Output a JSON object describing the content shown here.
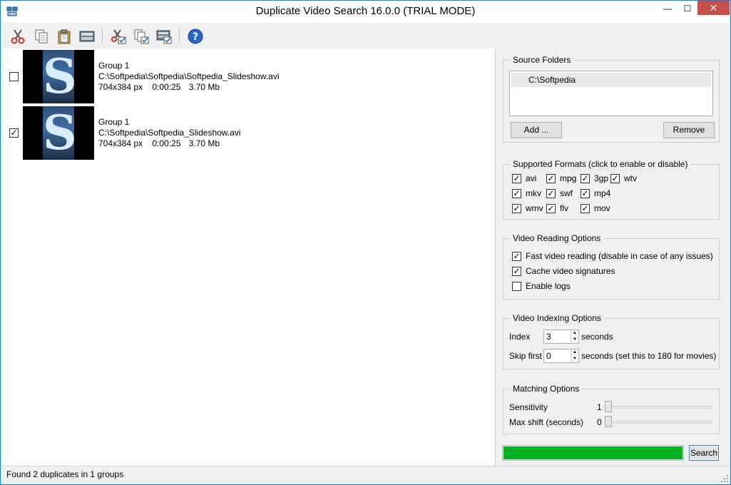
{
  "window": {
    "title": "Duplicate Video Search 16.0.0 (TRIAL MODE)",
    "minimize_glyph": "—",
    "maximize_glyph": "☐",
    "close_glyph": "✕"
  },
  "toolbar": {
    "buttons": [
      {
        "name": "cut-icon"
      },
      {
        "name": "copy-icon"
      },
      {
        "name": "paste-icon"
      },
      {
        "name": "delete-icon"
      },
      {
        "name": "cut-checked-icon"
      },
      {
        "name": "copy-checked-icon"
      },
      {
        "name": "delete-checked-icon"
      },
      {
        "name": "help-icon"
      }
    ],
    "help_glyph": "?"
  },
  "results": [
    {
      "checked": false,
      "group": "Group 1",
      "path": "C:\\Softpedia\\Softpedia\\Softpedia_Slideshow.avi",
      "resolution": "704x384 px",
      "duration": "0:00:25",
      "size": "3.70 Mb",
      "thumb_letter": "S"
    },
    {
      "checked": true,
      "group": "Group 1",
      "path": "C:\\Softpedia\\Softpedia_Slideshow.avi",
      "resolution": "704x384 px",
      "duration": "0:00:25",
      "size": "3.70 Mb",
      "thumb_letter": "S"
    }
  ],
  "source_folders": {
    "title": "Source Folders",
    "items": [
      "C:\\Softpedia"
    ],
    "add_label": "Add ...",
    "remove_label": "Remove"
  },
  "formats": {
    "title": "Supported Formats (click to enable or disable)",
    "items": [
      {
        "label": "avi",
        "checked": true
      },
      {
        "label": "mpg",
        "checked": true
      },
      {
        "label": "3gp",
        "checked": true
      },
      {
        "label": "wtv",
        "checked": true
      },
      {
        "label": "mkv",
        "checked": true
      },
      {
        "label": "swf",
        "checked": true
      },
      {
        "label": "mp4",
        "checked": true
      },
      {
        "label": "wmv",
        "checked": true
      },
      {
        "label": "flv",
        "checked": true
      },
      {
        "label": "mov",
        "checked": true
      }
    ]
  },
  "reading": {
    "title": "Video Reading Options",
    "options": [
      {
        "label": "Fast video reading (disable in case of any issues)",
        "checked": true
      },
      {
        "label": "Cache video signatures",
        "checked": true
      },
      {
        "label": "Enable logs",
        "checked": false
      }
    ]
  },
  "indexing": {
    "title": "Video Indexing Options",
    "index_label": "Index",
    "index_value": "3",
    "index_unit": "seconds",
    "skip_label": "Skip first",
    "skip_value": "0",
    "skip_unit": "seconds (set this to 180 for movies)"
  },
  "matching": {
    "title": "Matching Options",
    "sensitivity_label": "Sensitivity",
    "sensitivity_value": "1",
    "maxshift_label": "Max shift (seconds)",
    "maxshift_value": "0"
  },
  "progress": {
    "value": 1.0,
    "color": "#06b025"
  },
  "search_label": "Search",
  "status": "Found 2 duplicates in 1 groups",
  "check_glyph": "✓",
  "spin_up": "▲",
  "spin_down": "▼"
}
